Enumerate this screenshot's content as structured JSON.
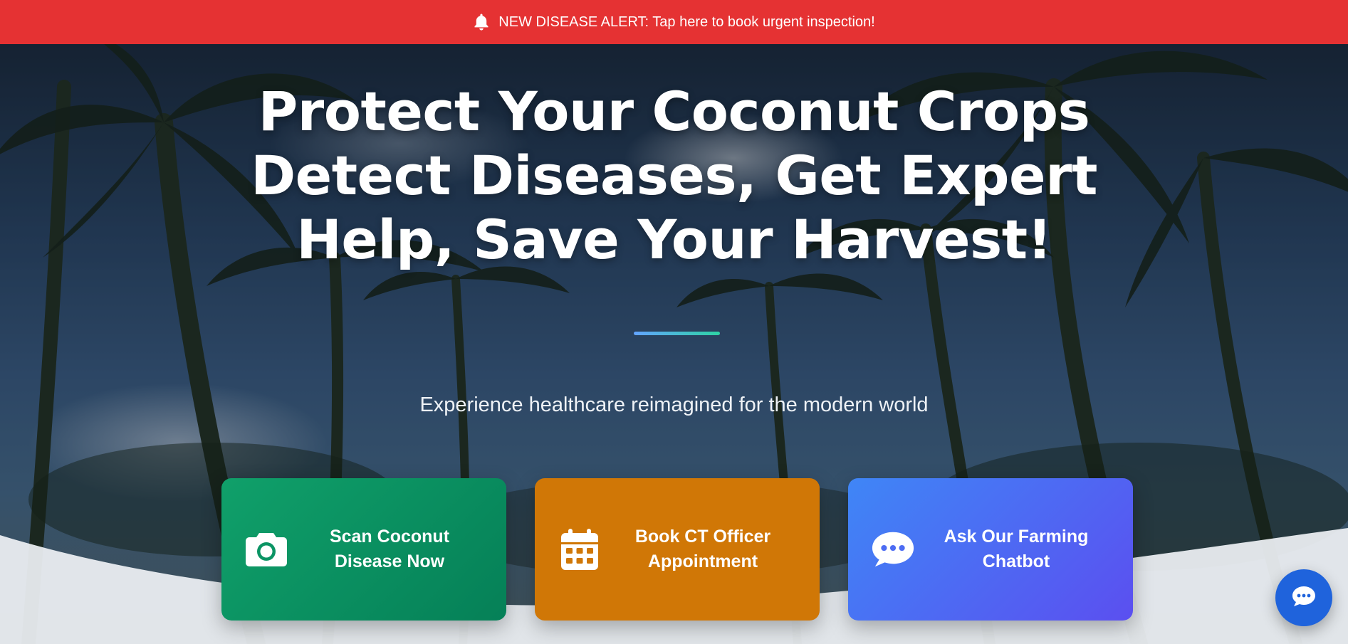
{
  "alert": {
    "icon": "bell-icon",
    "text": "NEW DISEASE ALERT: Tap here to book urgent inspection!",
    "background": "#e53233"
  },
  "hero": {
    "headline": [
      "Protect Your Coconut Crops",
      "Detect Diseases, Get Expert",
      "Help, Save Your Harvest!"
    ],
    "tagline": "Experience healthcare reimagined for the modern world",
    "background_image": "coconut-palm-trees"
  },
  "actions": [
    {
      "label": "Scan Coconut Disease Now",
      "icon": "camera-icon",
      "color": "#0a8f61"
    },
    {
      "label": "Book CT Officer Appointment",
      "icon": "calendar-icon",
      "color": "#d07706"
    },
    {
      "label": "Ask Our Farming Chatbot",
      "icon": "chat-bubble-icon",
      "color": "#4c6af3"
    }
  ],
  "chat_fab": {
    "icon": "chat-icon",
    "color": "#1f63dc"
  }
}
